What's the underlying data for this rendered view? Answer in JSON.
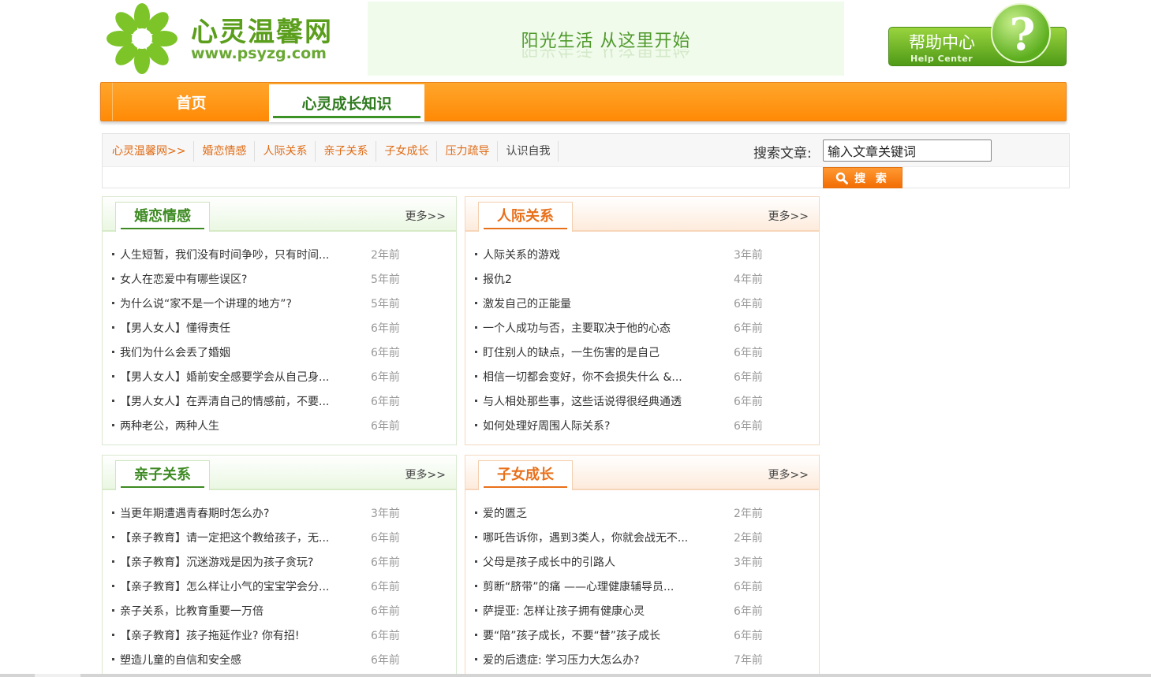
{
  "logo": {
    "name": "心灵温馨网",
    "url": "www.psyzg.com"
  },
  "banner": {
    "slogan": "阳光生活 从这里开始"
  },
  "help": {
    "title": "帮助中心",
    "subtitle": "Help Center",
    "symbol": "?"
  },
  "nav": {
    "home": "首页",
    "active": "心灵成长知识"
  },
  "categories": [
    "心灵温馨网>>",
    "婚恋情感",
    "人际关系",
    "亲子关系",
    "子女成长",
    "压力疏导",
    "认识自我"
  ],
  "search": {
    "label": "搜索文章:",
    "value": "输入文章关键词",
    "button": "搜 索"
  },
  "panels": [
    {
      "title": "婚恋情感",
      "more": "更多>>",
      "theme": "green",
      "items": [
        {
          "title": "人生短暂，我们没有时间争吵，只有时间...",
          "time": "2年前"
        },
        {
          "title": "女人在恋爱中有哪些误区?",
          "time": "5年前"
        },
        {
          "title": "为什么说“家不是一个讲理的地方”?",
          "time": "5年前"
        },
        {
          "title": "【男人女人】懂得责任",
          "time": "6年前"
        },
        {
          "title": "我们为什么会丢了婚姻",
          "time": "6年前"
        },
        {
          "title": "【男人女人】婚前安全感要学会从自己身...",
          "time": "6年前"
        },
        {
          "title": "【男人女人】在弄清自己的情感前，不要...",
          "time": "6年前"
        },
        {
          "title": "两种老公，两种人生",
          "time": "6年前"
        }
      ]
    },
    {
      "title": "人际关系",
      "more": "更多>>",
      "theme": "orange",
      "items": [
        {
          "title": "人际关系的游戏",
          "time": "3年前"
        },
        {
          "title": "报仇2",
          "time": "4年前"
        },
        {
          "title": "激发自己的正能量",
          "time": "6年前"
        },
        {
          "title": "一个人成功与否，主要取决于他的心态",
          "time": "6年前"
        },
        {
          "title": "盯住别人的缺点，一生伤害的是自己",
          "time": "6年前"
        },
        {
          "title": "相信一切都会变好，你不会损失什么 &...",
          "time": "6年前"
        },
        {
          "title": "与人相处那些事，这些话说得很经典通透",
          "time": "6年前"
        },
        {
          "title": "如何处理好周围人际关系?",
          "time": "6年前"
        }
      ]
    },
    {
      "title": "亲子关系",
      "more": "更多>>",
      "theme": "green",
      "items": [
        {
          "title": "当更年期遭遇青春期时怎么办?",
          "time": "3年前"
        },
        {
          "title": "【亲子教育】请一定把这个教给孩子，无...",
          "time": "6年前"
        },
        {
          "title": "【亲子教育】沉迷游戏是因为孩子贪玩?",
          "time": "6年前"
        },
        {
          "title": "【亲子教育】怎么样让小气的宝宝学会分...",
          "time": "6年前"
        },
        {
          "title": "亲子关系，比教育重要一万倍",
          "time": "6年前"
        },
        {
          "title": "【亲子教育】孩子拖延作业? 你有招!",
          "time": "6年前"
        },
        {
          "title": "塑造儿童的自信和安全感",
          "time": "6年前"
        }
      ]
    },
    {
      "title": "子女成长",
      "more": "更多>>",
      "theme": "orange",
      "items": [
        {
          "title": "爱的匮乏",
          "time": "2年前"
        },
        {
          "title": "哪吒告诉你，遇到3类人，你就会战无不...",
          "time": "2年前"
        },
        {
          "title": "父母是孩子成长中的引路人",
          "time": "3年前"
        },
        {
          "title": "剪断“脐带”的痛 ——心理健康辅导员...",
          "time": "6年前"
        },
        {
          "title": "萨提亚: 怎样让孩子拥有健康心灵",
          "time": "6年前"
        },
        {
          "title": "要“陪”孩子成长，不要“替”孩子成长",
          "time": "6年前"
        },
        {
          "title": "爱的后遗症: 学习压力大怎么办?",
          "time": "7年前"
        }
      ]
    }
  ],
  "colors": {
    "green": "#3d8a22",
    "orange": "#e8701a",
    "navOrange": "#ff8a06"
  }
}
